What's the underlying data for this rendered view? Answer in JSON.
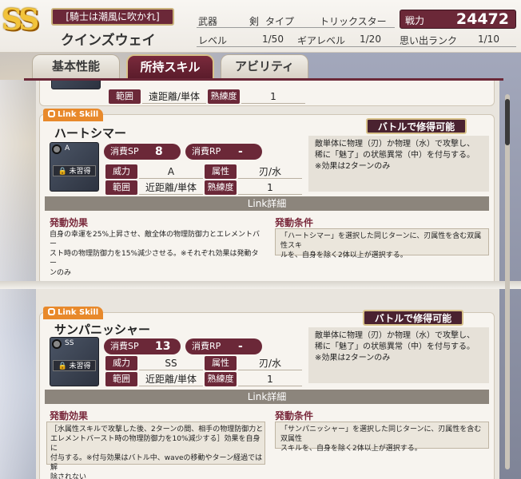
{
  "header": {
    "rank": "SS",
    "title": "[騎士は潮風に吹かれ]",
    "name": "クインズウェイ",
    "weapon_label": "武器",
    "weapon_value": "剣",
    "type_label": "タイプ",
    "type_value": "トリックスター",
    "power_label": "戦力",
    "power_value": "24472",
    "level_label": "レベル",
    "level_value": "1/50",
    "gear_label": "ギアレベル",
    "gear_value": "1/20",
    "memory_label": "思い出ランク",
    "memory_value": "1/10"
  },
  "tabs": [
    {
      "label": "基本性能"
    },
    {
      "label": "所持スキル"
    },
    {
      "label": "アビリティ"
    }
  ],
  "partial_card": {
    "range_label": "範囲",
    "range_value": "遠距離/単体",
    "prof_label": "熟練度",
    "prof_value": "1"
  },
  "skills": [
    {
      "badge": "Link Skill",
      "name": "ハートシマー",
      "rank": "A",
      "unlearned": "未習得",
      "sp_label": "消費SP",
      "sp_value": "8",
      "rp_label": "消費RP",
      "rp_value": "-",
      "power_label": "威力",
      "power_value": "A",
      "attr_label": "属性",
      "attr_value": "刃/水",
      "range_label": "範囲",
      "range_value": "近距離/単体",
      "prof_label": "熟練度",
      "prof_value": "1",
      "battle_badge": "バトルで修得可能",
      "desc_line1": "敵単体に物理（刃）か物理（水）で攻撃し、",
      "desc_line2": "稀に「魅了」の状態異常（中）を付与する。",
      "desc_line3": "※効果は2ターンのみ",
      "link_detail": "Link詳細",
      "effect_title": "発動効果",
      "effect_line1": "自身の幸運を25%上昇させ、敵全体の物理防御力とエレメントバー",
      "effect_line2": "スト時の物理防御力を15%減少させる。※それぞれ効果は発動ター",
      "effect_line3": "ンのみ",
      "cond_title": "発動条件",
      "cond_line1": "「ハートシマー」を選択した同じターンに、刃属性を含む双属性スキ",
      "cond_line2": "ルを、自身を除く2体以上が選択する。"
    },
    {
      "badge": "Link Skill",
      "name": "サンパニッシャー",
      "rank": "SS",
      "unlearned": "未習得",
      "sp_label": "消費SP",
      "sp_value": "13",
      "rp_label": "消費RP",
      "rp_value": "-",
      "power_label": "威力",
      "power_value": "SS",
      "attr_label": "属性",
      "attr_value": "刃/水",
      "range_label": "範囲",
      "range_value": "近距離/単体",
      "prof_label": "熟練度",
      "prof_value": "1",
      "battle_badge": "バトルで修得可能",
      "desc_line1": "敵単体に物理（刃）か物理（水）で攻撃し、",
      "desc_line2": "稀に「魅了」の状態異常（中）を付与する。",
      "desc_line3": "※効果は2ターンのみ",
      "link_detail": "Link詳細",
      "effect_title": "発動効果",
      "effect_line1": "［水属性スキルで攻撃した後、2ターンの間、相手の物理防御力と",
      "effect_line2": "エレメントバースト時の物理防御力を10%減少する］効果を自身に",
      "effect_line3": "付与する。※付与効果はバトル中、waveの移動やターン経過では解",
      "effect_line4": "除されない",
      "cond_title": "発動条件",
      "cond_line1": "「サンパニッシャー」を選択した同じターンに、刃属性を含む双属性",
      "cond_line2": "スキルを、自身を除く2体以上が選択する。"
    }
  ],
  "colors": {
    "accent": "#6b2838",
    "gold": "#d8c28a",
    "orange": "#e8892b"
  }
}
